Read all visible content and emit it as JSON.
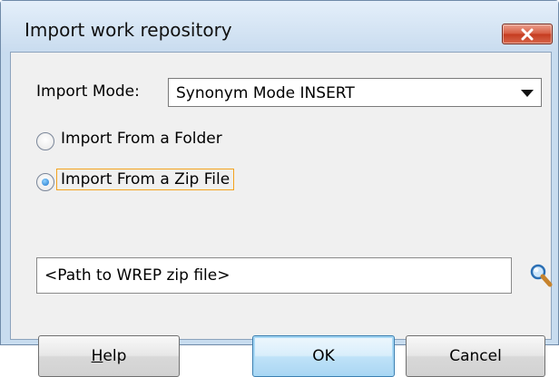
{
  "window": {
    "title": "Import work repository",
    "close_icon": "close-icon",
    "close_color": "#c43b1f"
  },
  "import_mode": {
    "label": "Import Mode:",
    "selected": "Synonym Mode INSERT",
    "arrow_icon": "chevron-down-icon"
  },
  "source_options": [
    {
      "label": "Import From a Folder",
      "checked": false
    },
    {
      "label": "Import From a Zip File",
      "checked": true,
      "focused": true
    }
  ],
  "path_field": {
    "value": "<Path to WREP zip file>",
    "browse_icon": "search-icon"
  },
  "buttons": {
    "help_mnemonic": "H",
    "help_rest": "elp",
    "ok": "OK",
    "cancel": "Cancel"
  },
  "colors": {
    "titlebar": "#c9dcef",
    "focus_outline": "#f4a21e",
    "default_button": "#a9d6f3"
  }
}
